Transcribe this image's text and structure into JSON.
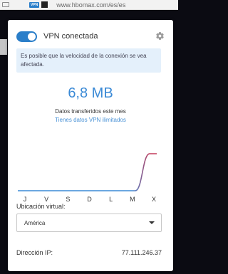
{
  "browser": {
    "url": "www.hbomax.com/es/es",
    "vpn_badge": "VPN"
  },
  "header": {
    "status": "VPN conectada",
    "vpn_enabled": true,
    "toggle_color": "#2a7ec9"
  },
  "notice": {
    "text": "Es posible que la velocidad de la conexión se vea afectada."
  },
  "usage": {
    "amount": "6,8 MB",
    "label": "Datos transferidos este mes",
    "plan": "Tienes datos VPN ilimitados",
    "accent_color": "#3b8ad6"
  },
  "chart_data": {
    "type": "line",
    "categories": [
      "J",
      "V",
      "S",
      "D",
      "L",
      "M",
      "X"
    ],
    "values": [
      0,
      0,
      0,
      0,
      0,
      0,
      6.8
    ],
    "ylim": [
      0,
      6.8
    ],
    "grid": false,
    "line_colors": [
      "#3b8ad6",
      "#c23b5a"
    ]
  },
  "location": {
    "label": "Ubicación virtual:",
    "selected": "América"
  },
  "ip": {
    "label": "Dirección IP:",
    "value": "77.111.246.37"
  }
}
